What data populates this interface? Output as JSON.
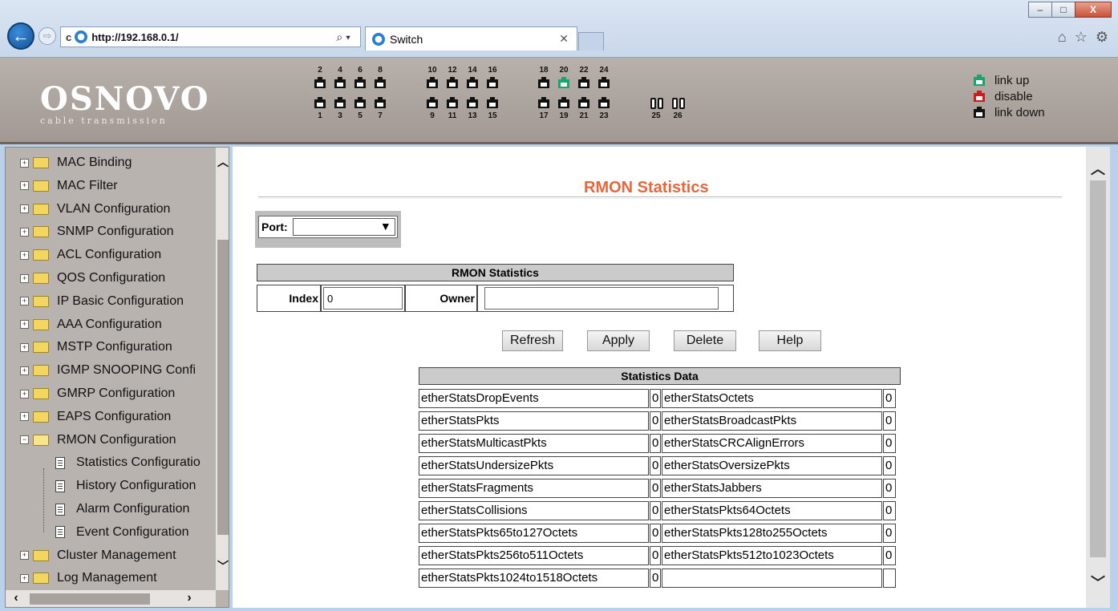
{
  "browser": {
    "url": "http://192.168.0.1/",
    "tab_title": "Switch",
    "window_buttons": [
      "–",
      "□",
      "X"
    ],
    "tools": [
      "home-icon",
      "star-icon",
      "gear-icon"
    ]
  },
  "header": {
    "logo_main": "OSNOVO",
    "logo_sub": "cable transmission",
    "ports_top": [
      "2",
      "4",
      "6",
      "8",
      "10",
      "12",
      "14",
      "16",
      "18",
      "20",
      "22",
      "24"
    ],
    "ports_bottom": [
      "1",
      "3",
      "5",
      "7",
      "9",
      "11",
      "13",
      "15",
      "17",
      "19",
      "21",
      "23"
    ],
    "fiber_ports": [
      "25",
      "26"
    ],
    "link_up_port": "20",
    "legend": [
      {
        "label": "link up",
        "color": "#1aa36a"
      },
      {
        "label": "disable",
        "color": "#d01b1b"
      },
      {
        "label": "link down",
        "color": "#111111"
      }
    ]
  },
  "sidebar": {
    "items": [
      {
        "label": "MAC Binding",
        "type": "folder"
      },
      {
        "label": "MAC Filter",
        "type": "folder"
      },
      {
        "label": "VLAN Configuration",
        "type": "folder"
      },
      {
        "label": "SNMP Configuration",
        "type": "folder"
      },
      {
        "label": "ACL Configuration",
        "type": "folder"
      },
      {
        "label": "QOS Configuration",
        "type": "folder"
      },
      {
        "label": "IP Basic Configuration",
        "type": "folder"
      },
      {
        "label": "AAA Configuration",
        "type": "folder"
      },
      {
        "label": "MSTP Configuration",
        "type": "folder"
      },
      {
        "label": "IGMP SNOOPING Confi",
        "type": "folder"
      },
      {
        "label": "GMRP Configuration",
        "type": "folder"
      },
      {
        "label": "EAPS Configuration",
        "type": "folder"
      },
      {
        "label": "RMON Configuration",
        "type": "folder-open"
      },
      {
        "label": "Statistics Configuratio",
        "type": "doc"
      },
      {
        "label": "History Configuration",
        "type": "doc"
      },
      {
        "label": "Alarm Configuration",
        "type": "doc"
      },
      {
        "label": "Event Configuration",
        "type": "doc"
      },
      {
        "label": "Cluster Management",
        "type": "folder"
      },
      {
        "label": "Log Management",
        "type": "folder"
      }
    ]
  },
  "main": {
    "title": "RMON Statistics",
    "port_label": "Port:",
    "port_value": "",
    "rmon_header": "RMON Statistics",
    "index_label": "Index",
    "index_value": "0",
    "owner_label": "Owner",
    "owner_value": "",
    "buttons": {
      "refresh": "Refresh",
      "apply": "Apply",
      "delete": "Delete",
      "help": "Help"
    },
    "stats_header": "Statistics Data",
    "stats": [
      [
        "etherStatsDropEvents",
        "0",
        "etherStatsOctets",
        "0"
      ],
      [
        "etherStatsPkts",
        "0",
        "etherStatsBroadcastPkts",
        "0"
      ],
      [
        "etherStatsMulticastPkts",
        "0",
        "etherStatsCRCAlignErrors",
        "0"
      ],
      [
        "etherStatsUndersizePkts",
        "0",
        "etherStatsOversizePkts",
        "0"
      ],
      [
        "etherStatsFragments",
        "0",
        "etherStatsJabbers",
        "0"
      ],
      [
        "etherStatsCollisions",
        "0",
        "etherStatsPkts64Octets",
        "0"
      ],
      [
        "etherStatsPkts65to127Octets",
        "0",
        "etherStatsPkts128to255Octets",
        "0"
      ],
      [
        "etherStatsPkts256to511Octets",
        "0",
        "etherStatsPkts512to1023Octets",
        "0"
      ],
      [
        "etherStatsPkts1024to1518Octets",
        "0",
        "",
        ""
      ]
    ]
  }
}
